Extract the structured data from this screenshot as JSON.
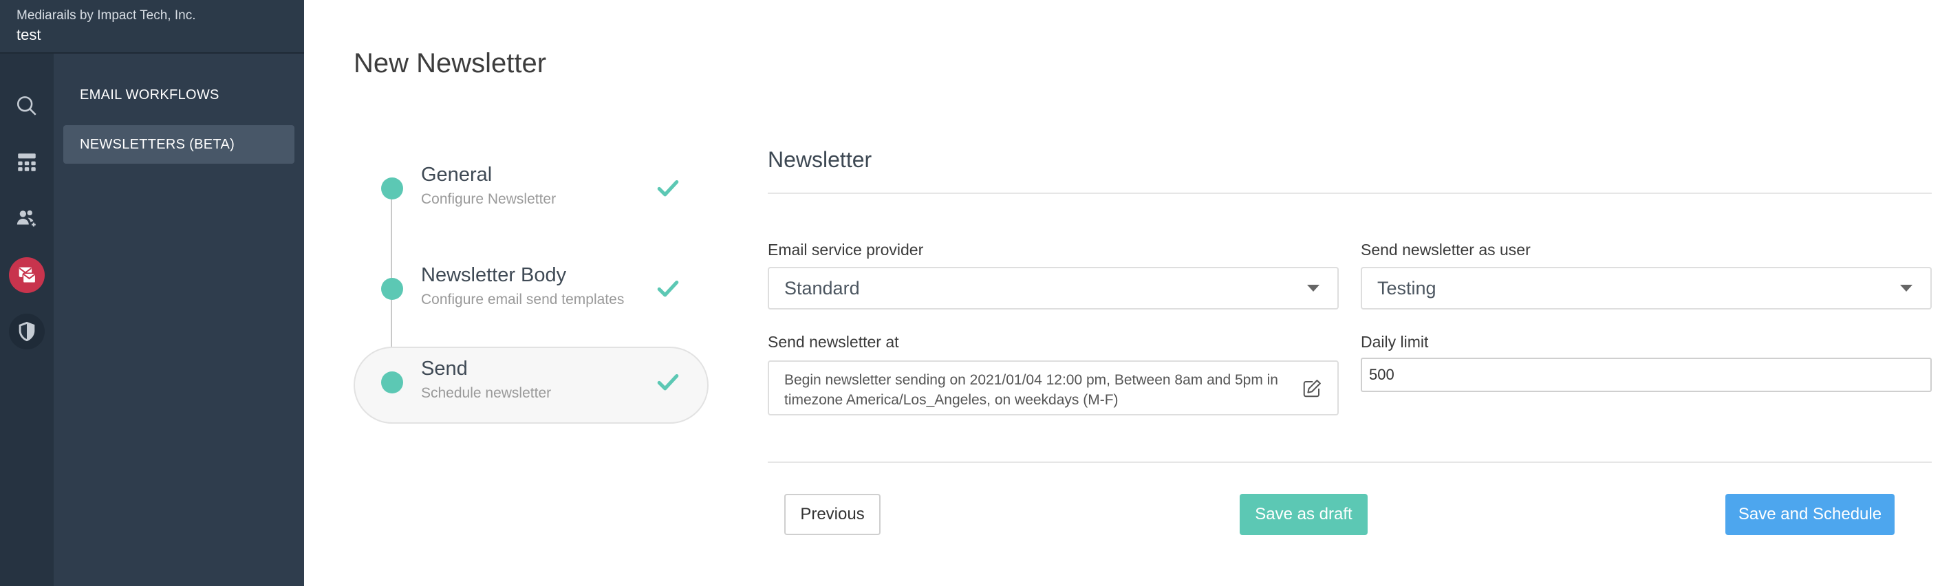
{
  "org": {
    "company": "Mediarails by Impact Tech, Inc.",
    "name": "test"
  },
  "rail": {
    "icons": [
      "search-icon",
      "workflow-icon",
      "users-icon",
      "newsletter-icon",
      "shield-icon"
    ],
    "active_color": "#c8344d"
  },
  "subnav": {
    "items": [
      {
        "label": "EMAIL WORKFLOWS",
        "selected": false
      },
      {
        "label": "NEWSLETTERS (BETA)",
        "selected": true
      }
    ]
  },
  "page": {
    "title": "New Newsletter"
  },
  "steps": [
    {
      "title": "General",
      "subtitle": "Configure Newsletter",
      "done": true
    },
    {
      "title": "Newsletter Body",
      "subtitle": "Configure email send templates",
      "done": true
    },
    {
      "title": "Send",
      "subtitle": "Schedule newsletter",
      "done": true,
      "current": true
    }
  ],
  "form": {
    "section_title": "Newsletter",
    "esp_label": "Email service provider",
    "esp_value": "Standard",
    "user_label": "Send newsletter as user",
    "user_value": "Testing",
    "schedule_label": "Send newsletter at",
    "schedule_value": "Begin newsletter sending on 2021/01/04 12:00 pm, Between 8am and 5pm in timezone America/Los_Angeles, on weekdays (M-F)",
    "limit_label": "Daily limit",
    "limit_value": "500"
  },
  "buttons": {
    "previous": "Previous",
    "draft": "Save as draft",
    "save": "Save and Schedule"
  },
  "colors": {
    "accent_teal": "#5cc8b4",
    "primary_blue": "#4da6ee",
    "sidebar_bg": "#2f3d4d"
  }
}
